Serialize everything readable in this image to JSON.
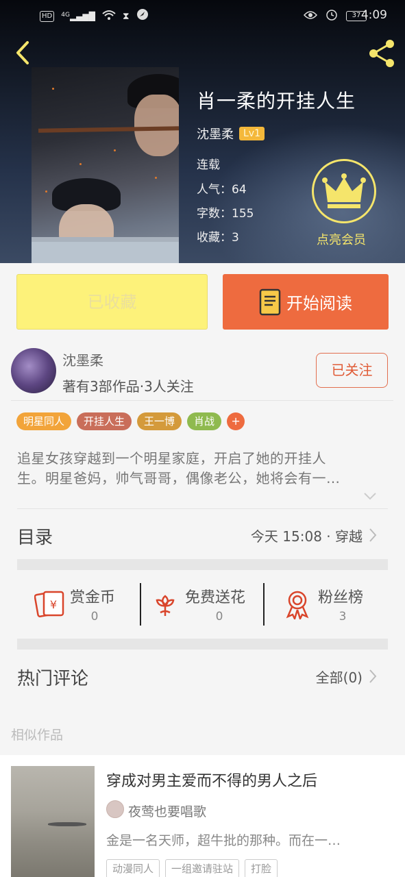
{
  "status_bar": {
    "hd": "HD",
    "network": "4G",
    "battery": "37",
    "time": "4:09"
  },
  "book": {
    "title": "肖一柔的开挂人生",
    "author": "沈墨柔",
    "level": "Lv1",
    "status": "连载",
    "popularity_label": "人气：",
    "popularity": "64",
    "words_label": "字数：",
    "words": "155",
    "collect_label": "收藏：",
    "collect": "3"
  },
  "vip": {
    "label": "点亮会员"
  },
  "actions": {
    "favorited": "已收藏",
    "start_reading": "开始阅读"
  },
  "author_card": {
    "name": "沈墨柔",
    "stats": "著有3部作品·3人关注",
    "follow": "已关注"
  },
  "tags": [
    {
      "label": "明星同人",
      "color": "#f2a43a"
    },
    {
      "label": "开挂人生",
      "color": "#c96e5a"
    },
    {
      "label": "王一博",
      "color": "#d49a3b"
    },
    {
      "label": "肖战",
      "color": "#8fba4f"
    },
    {
      "label": "+",
      "color": "#ee6b3f"
    }
  ],
  "description": {
    "line1": "追星女孩穿越到一个明星家庭，开启了她的开挂人",
    "line2": "生。明星爸妈，帅气哥哥，偶像老公，她将会有一…"
  },
  "toc": {
    "label": "目录",
    "latest": "今天 15:08 · 穿越"
  },
  "stats": [
    {
      "label": "赏金币",
      "value": "0",
      "icon": "red-envelope-icon"
    },
    {
      "label": "免费送花",
      "value": "0",
      "icon": "flower-icon"
    },
    {
      "label": "粉丝榜",
      "value": "3",
      "icon": "medal-icon"
    }
  ],
  "comments": {
    "label": "热门评论",
    "all": "全部(0)"
  },
  "similar": {
    "label": "相似作品",
    "items": [
      {
        "title": "穿成对男主爱而不得的男人之后",
        "author": "夜莺也要唱歌",
        "desc": "金是一名天师，超牛批的那种。而在一…",
        "tags": [
          "动漫同人",
          "一组邀请驻站",
          "打脸"
        ]
      }
    ]
  },
  "colors": {
    "accent": "#ee6b3f",
    "favorite_bg": "#fdf27a",
    "vip_gold": "#f5e56b"
  }
}
